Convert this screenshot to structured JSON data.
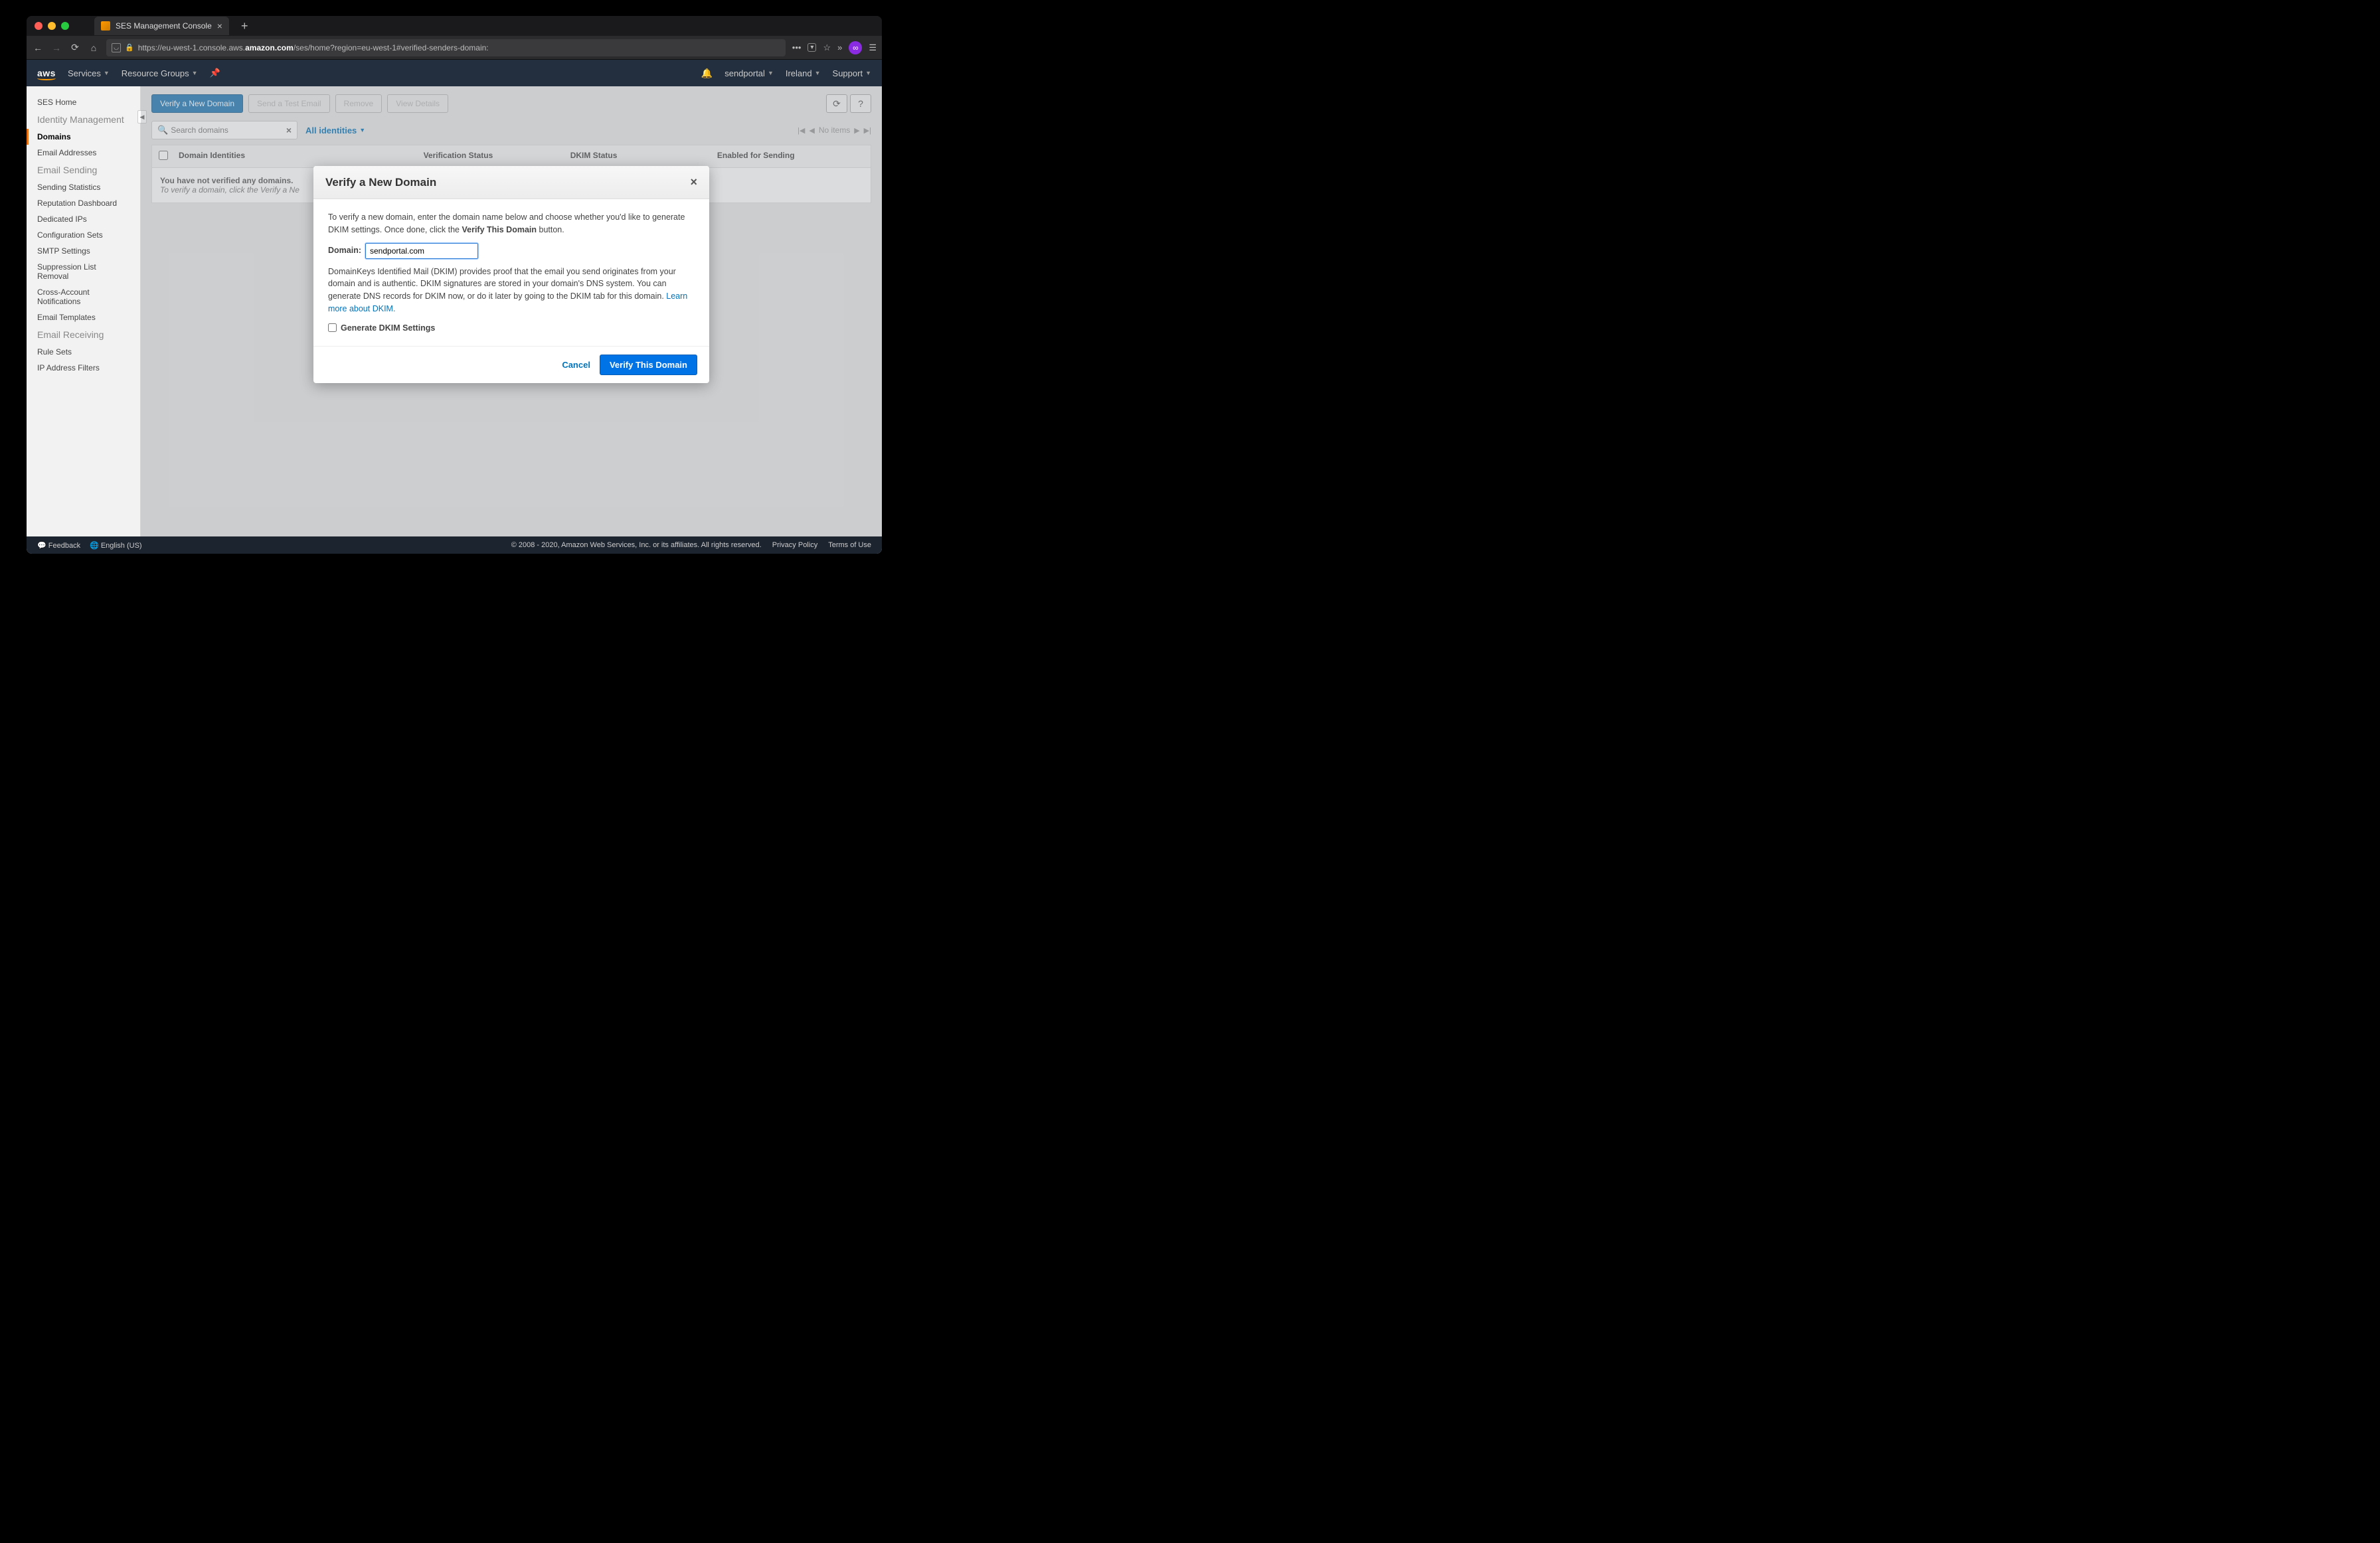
{
  "browser": {
    "tab_title": "SES Management Console",
    "url_prefix": "https://eu-west-1.console.aws.",
    "url_domain": "amazon.com",
    "url_suffix": "/ses/home?region=eu-west-1#verified-senders-domain:"
  },
  "nav": {
    "logo": "aws",
    "services": "Services",
    "resource_groups": "Resource Groups",
    "account": "sendportal",
    "region": "Ireland",
    "support": "Support"
  },
  "sidebar": {
    "home": "SES Home",
    "identity_heading": "Identity Management",
    "domains": "Domains",
    "email_addresses": "Email Addresses",
    "sending_heading": "Email Sending",
    "sending_stats": "Sending Statistics",
    "reputation": "Reputation Dashboard",
    "dedicated_ips": "Dedicated IPs",
    "config_sets": "Configuration Sets",
    "smtp": "SMTP Settings",
    "suppression": "Suppression List Removal",
    "cross_account": "Cross-Account Notifications",
    "templates": "Email Templates",
    "receiving_heading": "Email Receiving",
    "rule_sets": "Rule Sets",
    "ip_filters": "IP Address Filters"
  },
  "toolbar": {
    "verify": "Verify a New Domain",
    "send_test": "Send a Test Email",
    "remove": "Remove",
    "view_details": "View Details"
  },
  "search": {
    "placeholder": "Search domains",
    "filter": "All identities",
    "no_items": "No items"
  },
  "table": {
    "col1": "Domain Identities",
    "col2": "Verification Status",
    "col3": "DKIM Status",
    "col4": "Enabled for Sending",
    "empty_bold": "You have not verified any domains.",
    "empty_italic": "To verify a domain, click the Verify a Ne"
  },
  "modal": {
    "title": "Verify a New Domain",
    "p1a": "To verify a new domain, enter the domain name below and choose whether you'd like to generate DKIM settings. Once done, click the ",
    "p1b": "Verify This Domain",
    "p1c": " button.",
    "domain_label": "Domain:",
    "domain_value": "sendportal.com",
    "p2a": "DomainKeys Identified Mail (DKIM) provides proof that the email you send originates from your domain and is authentic. DKIM signatures are stored in your domain's DNS system. You can generate DNS records for DKIM now, or do it later by going to the DKIM tab for this domain. ",
    "p2link": "Learn more about DKIM.",
    "dkim_check": "Generate DKIM Settings",
    "cancel": "Cancel",
    "verify": "Verify This Domain"
  },
  "footer": {
    "feedback": "Feedback",
    "language": "English (US)",
    "copyright": "© 2008 - 2020, Amazon Web Services, Inc. or its affiliates. All rights reserved.",
    "privacy": "Privacy Policy",
    "terms": "Terms of Use"
  }
}
